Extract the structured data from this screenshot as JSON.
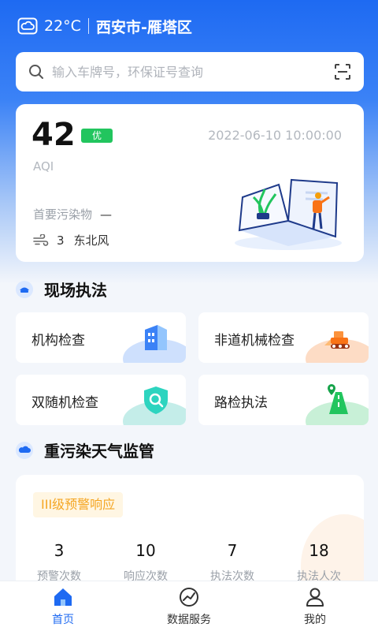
{
  "status": {
    "weather_icon": "cloud-icon",
    "temperature": "22°C",
    "location": "西安市-雁塔区"
  },
  "search": {
    "placeholder": "输入车牌号，环保证号查询",
    "scan_icon": "scan-icon"
  },
  "aqi": {
    "value": "42",
    "level": "优",
    "level_color": "#22c55e",
    "time": "2022-06-10 10:00:00",
    "label": "AQI",
    "pollutant_label": "首要污染物",
    "pollutant_value": "—",
    "wind_level": "3",
    "wind_direction": "东北风"
  },
  "onsite": {
    "title": "现场执法",
    "tiles": [
      {
        "label": "机构检查",
        "icon": "building-icon"
      },
      {
        "label": "非道机械检查",
        "icon": "bulldozer-icon"
      },
      {
        "label": "双随机检查",
        "icon": "shield-search-icon"
      },
      {
        "label": "路检执法",
        "icon": "road-pin-icon"
      }
    ]
  },
  "heavy": {
    "title": "重污染天气监管",
    "warning": "III级预警响应",
    "stats": [
      {
        "value": "3",
        "label": "预警次数"
      },
      {
        "value": "10",
        "label": "响应次数"
      },
      {
        "value": "7",
        "label": "执法次数"
      },
      {
        "value": "18",
        "label": "执法人次"
      }
    ]
  },
  "tabbar": {
    "tabs": [
      {
        "label": "首页",
        "icon": "home-icon",
        "active": true
      },
      {
        "label": "数据服务",
        "icon": "data-service-icon",
        "active": false
      },
      {
        "label": "我的",
        "icon": "user-icon",
        "active": false
      }
    ]
  },
  "colors": {
    "primary": "#1e6af2",
    "warning": "#f5a623"
  }
}
